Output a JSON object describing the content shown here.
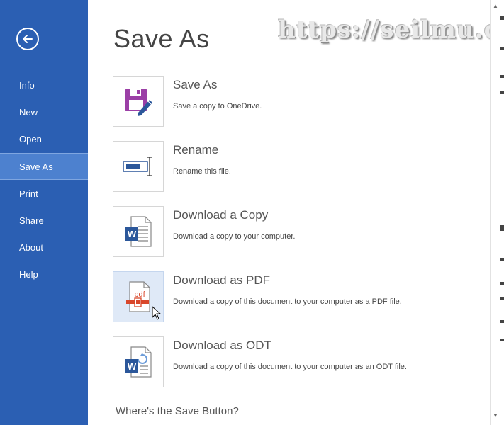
{
  "sidebar": {
    "items": [
      {
        "label": "Info"
      },
      {
        "label": "New"
      },
      {
        "label": "Open"
      },
      {
        "label": "Save As"
      },
      {
        "label": "Print"
      },
      {
        "label": "Share"
      },
      {
        "label": "About"
      },
      {
        "label": "Help"
      }
    ],
    "active_index": 3,
    "back_icon": "back-arrow-icon"
  },
  "main": {
    "title": "Save As",
    "watermark": "https://seilmu.com",
    "options": [
      {
        "title": "Save As",
        "desc": "Save a copy to OneDrive.",
        "icon": "floppy-disk-icon"
      },
      {
        "title": "Rename",
        "desc": "Rename this file.",
        "icon": "rename-icon"
      },
      {
        "title": "Download a Copy",
        "desc": "Download a copy to your computer.",
        "icon": "word-document-icon"
      },
      {
        "title": "Download as PDF",
        "desc": "Download a copy of this document to your computer as a PDF file.",
        "icon": "pdf-document-icon"
      },
      {
        "title": "Download as ODT",
        "desc": "Download a copy of this document to your computer as an ODT file.",
        "icon": "odt-document-icon"
      }
    ],
    "footer_link": "Where's the Save Button?"
  },
  "colors": {
    "sidebar_bg": "#2b5fb3",
    "sidebar_active": "#4d81cf",
    "word_blue": "#2b579a",
    "pdf_red": "#d9472b",
    "floppy_purple": "#9b3fa6"
  }
}
